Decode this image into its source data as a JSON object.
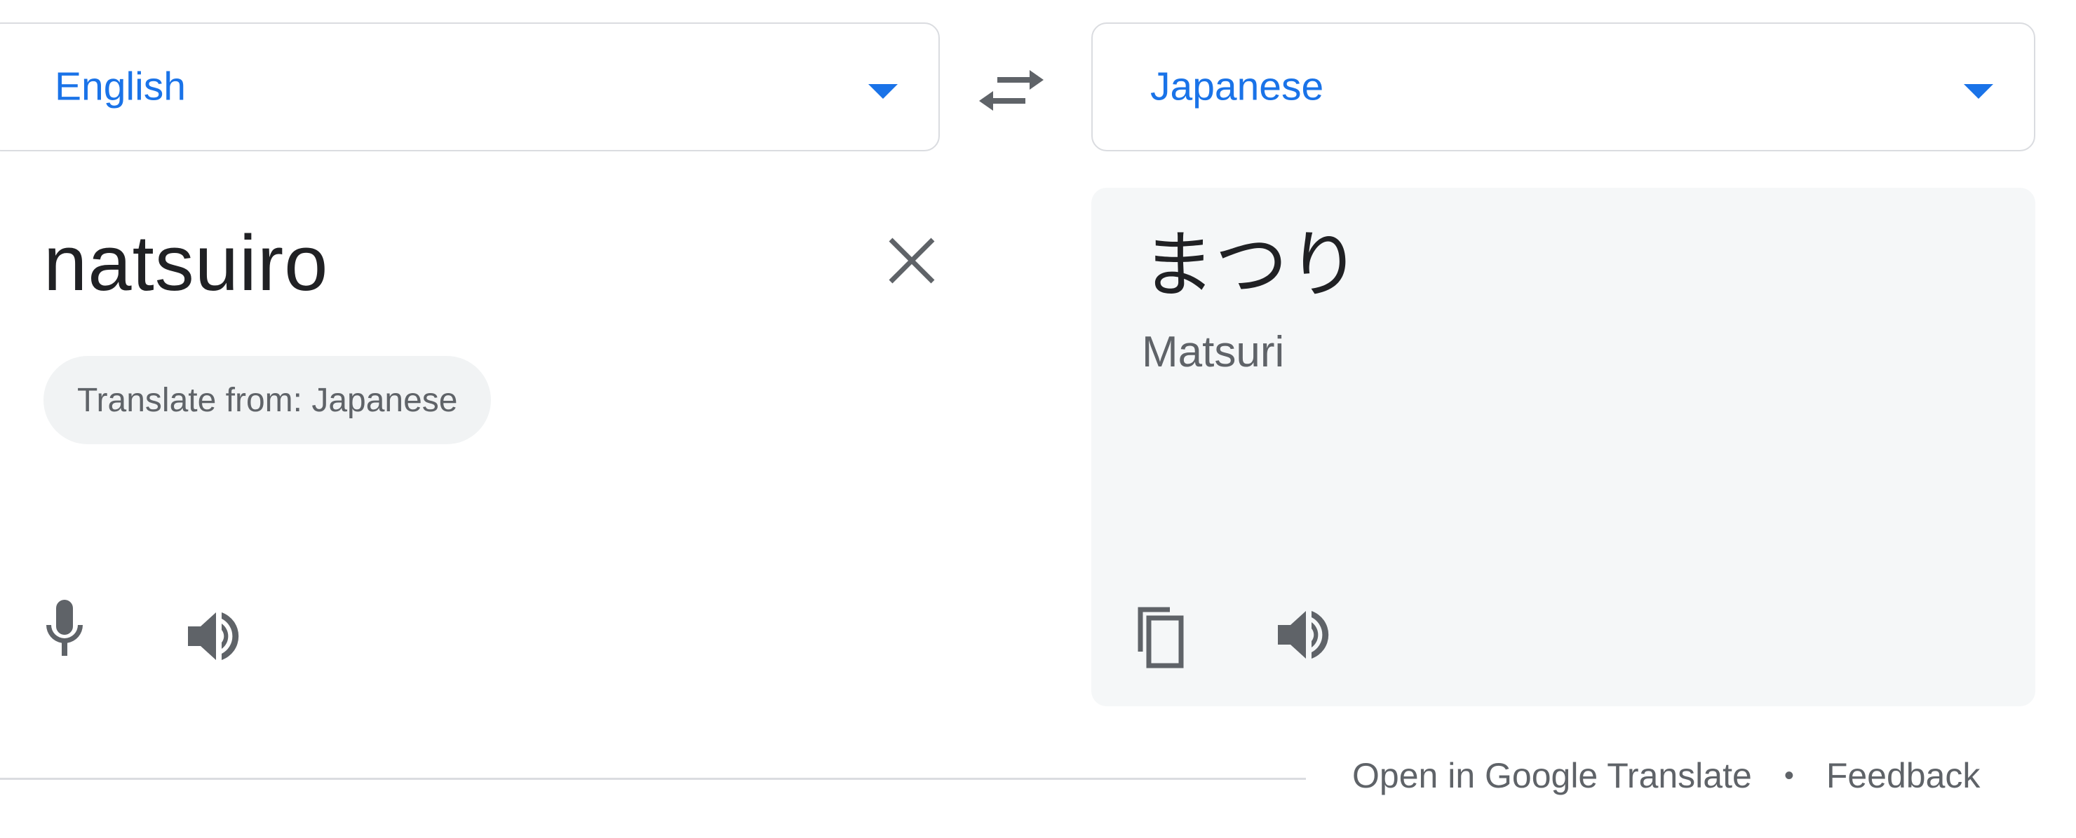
{
  "source_language": {
    "label": "English"
  },
  "target_language": {
    "label": "Japanese"
  },
  "input": {
    "text": "natsuiro",
    "detect_chip": "Translate from: Japanese"
  },
  "output": {
    "text": "まつり",
    "romanization": "Matsuri"
  },
  "footer": {
    "open_link": "Open in Google Translate",
    "separator": "•",
    "feedback_link": "Feedback"
  },
  "colors": {
    "accent": "#1a73e8",
    "icon_gray": "#5f6368",
    "panel_bg": "#f5f7f8"
  },
  "icons": {
    "swap": "swap-icon",
    "caret": "chevron-down-icon",
    "clear": "close-icon",
    "mic": "microphone-icon",
    "speaker": "speaker-icon",
    "copy": "copy-icon"
  }
}
